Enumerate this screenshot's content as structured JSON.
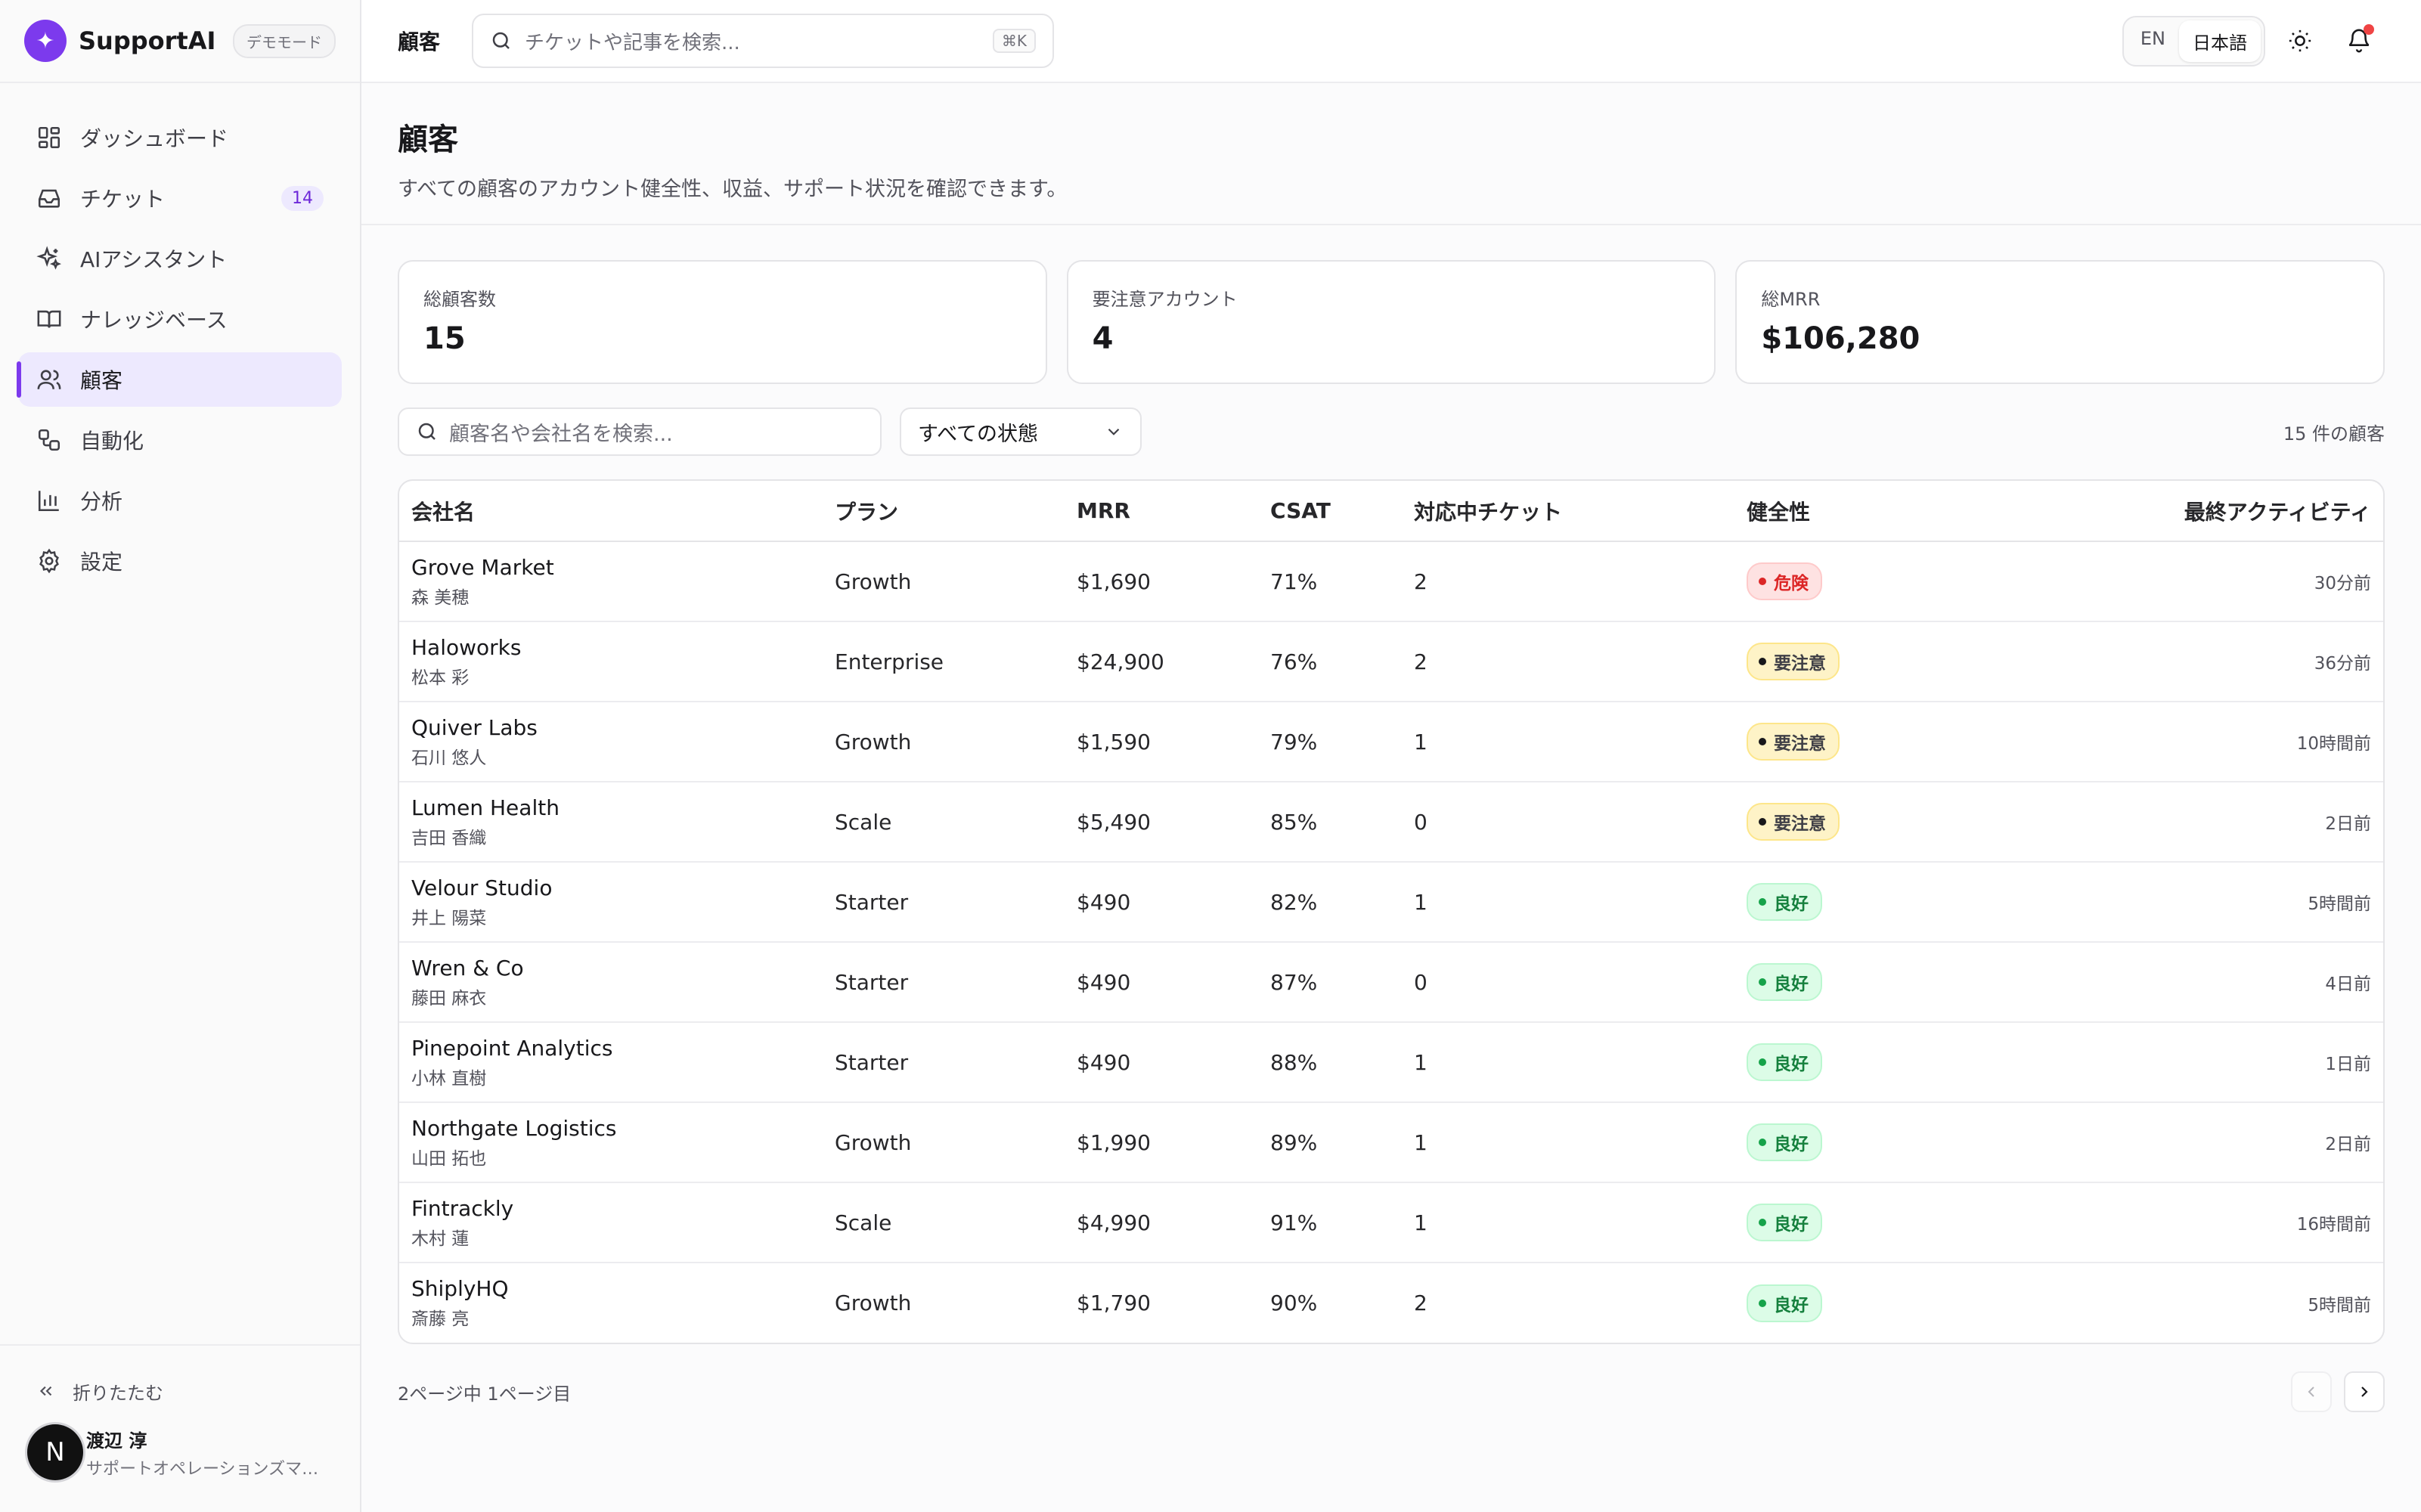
{
  "brand": {
    "name": "SupportAI",
    "mode_badge": "デモモード",
    "logo_icon": "sparkle-icon"
  },
  "sidebar": {
    "items": [
      {
        "label": "ダッシュボード",
        "icon": "dashboard-icon"
      },
      {
        "label": "チケット",
        "icon": "inbox-icon",
        "badge": "14"
      },
      {
        "label": "AIアシスタント",
        "icon": "sparkles-icon"
      },
      {
        "label": "ナレッジベース",
        "icon": "book-icon"
      },
      {
        "label": "顧客",
        "icon": "users-icon",
        "active": true
      },
      {
        "label": "自動化",
        "icon": "workflow-icon"
      },
      {
        "label": "分析",
        "icon": "bar-chart-icon"
      },
      {
        "label": "設定",
        "icon": "gear-icon"
      }
    ],
    "collapse_label": "折りたたむ",
    "user": {
      "initial": "N",
      "name": "渡辺 淳",
      "role": "サポートオペレーションズマ…"
    }
  },
  "topbar": {
    "title": "顧客",
    "search_placeholder": "チケットや記事を検索...",
    "shortcut": "⌘K",
    "lang_en": "EN",
    "lang_ja": "日本語"
  },
  "page": {
    "title": "顧客",
    "description": "すべての顧客のアカウント健全性、収益、サポート状況を確認できます。"
  },
  "stats": [
    {
      "label": "総顧客数",
      "value": "15"
    },
    {
      "label": "要注意アカウント",
      "value": "4"
    },
    {
      "label": "総MRR",
      "value": "$106,280"
    }
  ],
  "filters": {
    "search_placeholder": "顧客名や会社名を検索...",
    "status_select": "すべての状態",
    "count": "15 件の顧客"
  },
  "table": {
    "headers": [
      "会社名",
      "プラン",
      "MRR",
      "CSAT",
      "対応中チケット",
      "健全性",
      "最終アクティビティ"
    ],
    "rows": [
      {
        "company": "Grove Market",
        "contact": "森 美穂",
        "plan": "Growth",
        "mrr": "$1,690",
        "csat": "71%",
        "open": "2",
        "health": "危険",
        "health_type": "danger",
        "last": "30分前"
      },
      {
        "company": "Haloworks",
        "contact": "松本 彩",
        "plan": "Enterprise",
        "mrr": "$24,900",
        "csat": "76%",
        "open": "2",
        "health": "要注意",
        "health_type": "warn",
        "last": "36分前"
      },
      {
        "company": "Quiver Labs",
        "contact": "石川 悠人",
        "plan": "Growth",
        "mrr": "$1,590",
        "csat": "79%",
        "open": "1",
        "health": "要注意",
        "health_type": "warn",
        "last": "10時間前"
      },
      {
        "company": "Lumen Health",
        "contact": "吉田 香織",
        "plan": "Scale",
        "mrr": "$5,490",
        "csat": "85%",
        "open": "0",
        "health": "要注意",
        "health_type": "warn",
        "last": "2日前"
      },
      {
        "company": "Velour Studio",
        "contact": "井上 陽菜",
        "plan": "Starter",
        "mrr": "$490",
        "csat": "82%",
        "open": "1",
        "health": "良好",
        "health_type": "good",
        "last": "5時間前"
      },
      {
        "company": "Wren & Co",
        "contact": "藤田 麻衣",
        "plan": "Starter",
        "mrr": "$490",
        "csat": "87%",
        "open": "0",
        "health": "良好",
        "health_type": "good",
        "last": "4日前"
      },
      {
        "company": "Pinepoint Analytics",
        "contact": "小林 直樹",
        "plan": "Starter",
        "mrr": "$490",
        "csat": "88%",
        "open": "1",
        "health": "良好",
        "health_type": "good",
        "last": "1日前"
      },
      {
        "company": "Northgate Logistics",
        "contact": "山田 拓也",
        "plan": "Growth",
        "mrr": "$1,990",
        "csat": "89%",
        "open": "1",
        "health": "良好",
        "health_type": "good",
        "last": "2日前"
      },
      {
        "company": "Fintrackly",
        "contact": "木村 蓮",
        "plan": "Scale",
        "mrr": "$4,990",
        "csat": "91%",
        "open": "1",
        "health": "良好",
        "health_type": "good",
        "last": "16時間前"
      },
      {
        "company": "ShiplyHQ",
        "contact": "斎藤 亮",
        "plan": "Growth",
        "mrr": "$1,790",
        "csat": "90%",
        "open": "2",
        "health": "良好",
        "health_type": "good",
        "last": "5時間前"
      }
    ]
  },
  "pagination": {
    "info": "2ページ中 1ページ目"
  },
  "colors": {
    "accent": "#7c3aed",
    "danger": "#dc2626",
    "warn": "#fde68a",
    "good": "#16a34a"
  }
}
